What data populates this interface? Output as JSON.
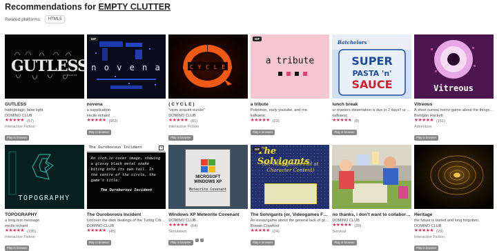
{
  "header": {
    "prefix": "Recommendations for ",
    "game": "EMPTY CLUTTER"
  },
  "platforms": {
    "label": "Related platforms:",
    "tag": "HTML5"
  },
  "play_label": "Play in browser",
  "gif_label": "GIF",
  "games": [
    {
      "title": "GUTLESS",
      "desc": "hadopelagic false light",
      "author": "DOMINO CLUB",
      "rating": 4.5,
      "count": "(57)",
      "genre": "Interactive Fiction",
      "gif": false,
      "thumb_text": "GUTLESS"
    },
    {
      "title": "novena",
      "desc": "a supplication",
      "author": "eecile richard",
      "rating": 5,
      "count": "(953)",
      "genre": "",
      "gif": true,
      "thumb_text": "n o v e n a"
    },
    {
      "title": "( C Y C L E )",
      "desc": "\"vires acquirit eundo\"",
      "author": "DOMINO CLUB",
      "rating": 5,
      "count": "(81)",
      "genre": "Interactive Fiction",
      "gif": false,
      "thumb_text": "(cycle)"
    },
    {
      "title": "a tribute",
      "desc": "Pokémon, early youtube, and me.",
      "author": "kafkaesc",
      "rating": 4.5,
      "count": "(23)",
      "genre": "",
      "gif": true,
      "thumb_text": "a tribute"
    },
    {
      "title": "lunch break",
      "desc": "ur masters dissertation is due in 2 days!! ur ...",
      "author": "kafkaesc",
      "rating": 4.5,
      "count": "(8)",
      "genre": "",
      "gif": false,
      "thumb_text": "SUPER PASTA'n' SAUCE"
    },
    {
      "title": "Vitreous",
      "desc": "A short surreal horror game about the things...",
      "author": "Breogán Hackett",
      "rating": 5,
      "count": "(151)",
      "genre": "Adventure",
      "gif": false,
      "thumb_text": "Vitreous"
    },
    {
      "title": "TOPOGRAPHY",
      "desc": "a long text message",
      "author": "eecile richard",
      "rating": 5,
      "count": "(195)",
      "genre": "Interactive Fiction",
      "gif": false,
      "thumb_text": "TOPOGRAPHY"
    },
    {
      "title": "The Ouroborous Incident",
      "desc": "Uncover the dark dealings of the Turing Corp...",
      "author": "DOMINO CLUB",
      "rating": 5,
      "count": "(45)",
      "genre": "",
      "gif": false,
      "thumb_text": "The Ouroborous Incident",
      "thumb_body": "An itch.io cover image, showing a glossy black metal snake biting onto its own tail. In the centre of the circle, the game's title:"
    },
    {
      "title": "Windows XP Meteorite Covenant",
      "desc": "",
      "author": "DOMINO CLUB",
      "rating": 5,
      "count": "(64)",
      "genre": "Simulation",
      "gif": false,
      "thumb_text": "MICROSOFT WINDOWS XP",
      "thumb_sub": "Meteorite Covenant"
    },
    {
      "title": "The Solvigants (or, Videogames Fail at Character Context)",
      "desc": "An essay/game about the general lack of grea...",
      "author": "Rowan Crawford",
      "rating": 5,
      "count": "(24)",
      "genre": "",
      "gif": true,
      "thumb_text": "The Solvigants",
      "thumb_sub": "(or, Videogames Fail at Character Context)"
    },
    {
      "title": "no thanks, i don't want to collaborate :)",
      "desc": "",
      "author": "DOMINO CLUB",
      "rating": 4.5,
      "count": "(39)",
      "genre": "Survival",
      "gif": false,
      "thumb_text": ""
    },
    {
      "title": "Heritage",
      "desc": "the future is buried and long forgotten",
      "author": "DOMINO CLUB",
      "rating": 5,
      "count": "(29)",
      "genre": "Interactive Fiction",
      "gif": false,
      "thumb_text": ""
    }
  ]
}
